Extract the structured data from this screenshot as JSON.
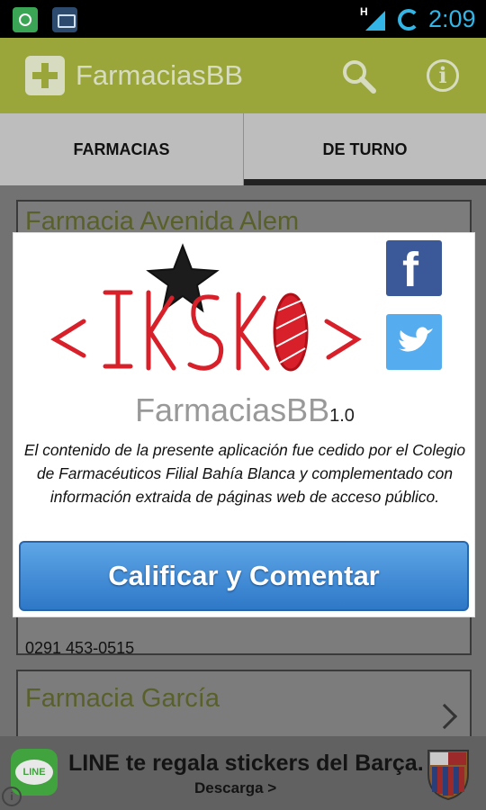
{
  "status_bar": {
    "time": "2:09",
    "network": "H",
    "notification_icons": [
      "notification-app-icon",
      "camera-icon"
    ]
  },
  "action_bar": {
    "title": "FarmaciasBB",
    "icons": [
      "app-plus-icon",
      "search-icon",
      "info-icon"
    ]
  },
  "tabs": [
    {
      "label": "FARMACIAS",
      "selected": false
    },
    {
      "label": "DE TURNO",
      "selected": true
    }
  ],
  "list": {
    "items": [
      {
        "name": "Farmacia Avenida Alem",
        "phone": "0291 453-0515"
      },
      {
        "name": "Farmacia García",
        "phone": ""
      }
    ]
  },
  "dialog": {
    "logo_text": "<IKSKO>",
    "app_name": "FarmaciasBB",
    "version": "1.0",
    "description": "El contenido de la presente aplicación fue cedido por el Colegio de Farmacéuticos Filial Bahía Blanca y complementado con información extraida de páginas web de acceso público.",
    "button_label": "Calificar y Comentar",
    "social": [
      "facebook-icon",
      "twitter-icon"
    ]
  },
  "ad": {
    "logo_label": "LINE",
    "text": "LINE te regala stickers del Barça.",
    "cta": "Descarga >"
  },
  "colors": {
    "action_bar": "#9aa63a",
    "accent_blue": "#33b5e5",
    "button_blue": "#3b88d6",
    "facebook": "#3b5998",
    "twitter": "#55acee",
    "logo_red": "#d8202a"
  }
}
